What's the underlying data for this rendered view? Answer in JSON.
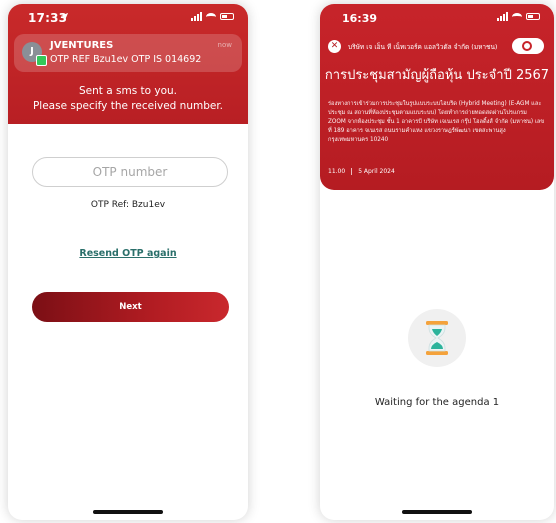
{
  "left_phone": {
    "status_time": "17:33",
    "notification": {
      "app_initial": "J",
      "title": "JVENTURES",
      "body": "OTP REF Bzu1ev OTP IS 014692",
      "time": "now"
    },
    "instruction_line1": "Sent a sms to you.",
    "instruction_line2": "Please specify the received number.",
    "otp_placeholder": "OTP number",
    "otp_ref": "OTP Ref: Bzu1ev",
    "resend_label": "Resend OTP again",
    "next_label": "Next"
  },
  "right_phone": {
    "status_time": "16:39",
    "company": "บริษัท เจ เอ็น ที เน็ทเวอร์ค แอลวิวตัล จำกัด (มหาชน)",
    "meeting_title": "การประชุมสามัญผู้ถือหุ้น ประจำปี 2567",
    "description": "ร่องทางการเข้าร่วมการประชุมในรูปแบบระบบไฮบริด (Hybrid Meeting) (E-AGM และประชุม ณ สถานที่ห้องประชุมตามแบบระบบ) โดยทำการถ่ายทอดสดผ่านโปรแกรม ZOOM จากห้องประชุม ชั้น 1 อาคารบี บริษัท เจเนเรส กรุ๊ป โฮลดิ้งส์ จำกัด (มหาชน) เลขที่ 189 อาคาร จเนเรส ถนนรามคำแหง แขวงราษฎร์พัฒนา เขตสะพานสูง กรุงเทพมหานคร 10240",
    "meeting_time": "11.00",
    "meeting_date": "5 April 2024",
    "waiting_text": "Waiting for the agenda 1"
  },
  "colors": {
    "brand_red": "#c7242a",
    "dark_red": "#7b0f15",
    "link_teal": "#2a6f6a"
  },
  "icons": [
    "location-arrow-icon",
    "signal-icon",
    "wifi-icon",
    "battery-icon",
    "close-icon",
    "hourglass-icon"
  ]
}
